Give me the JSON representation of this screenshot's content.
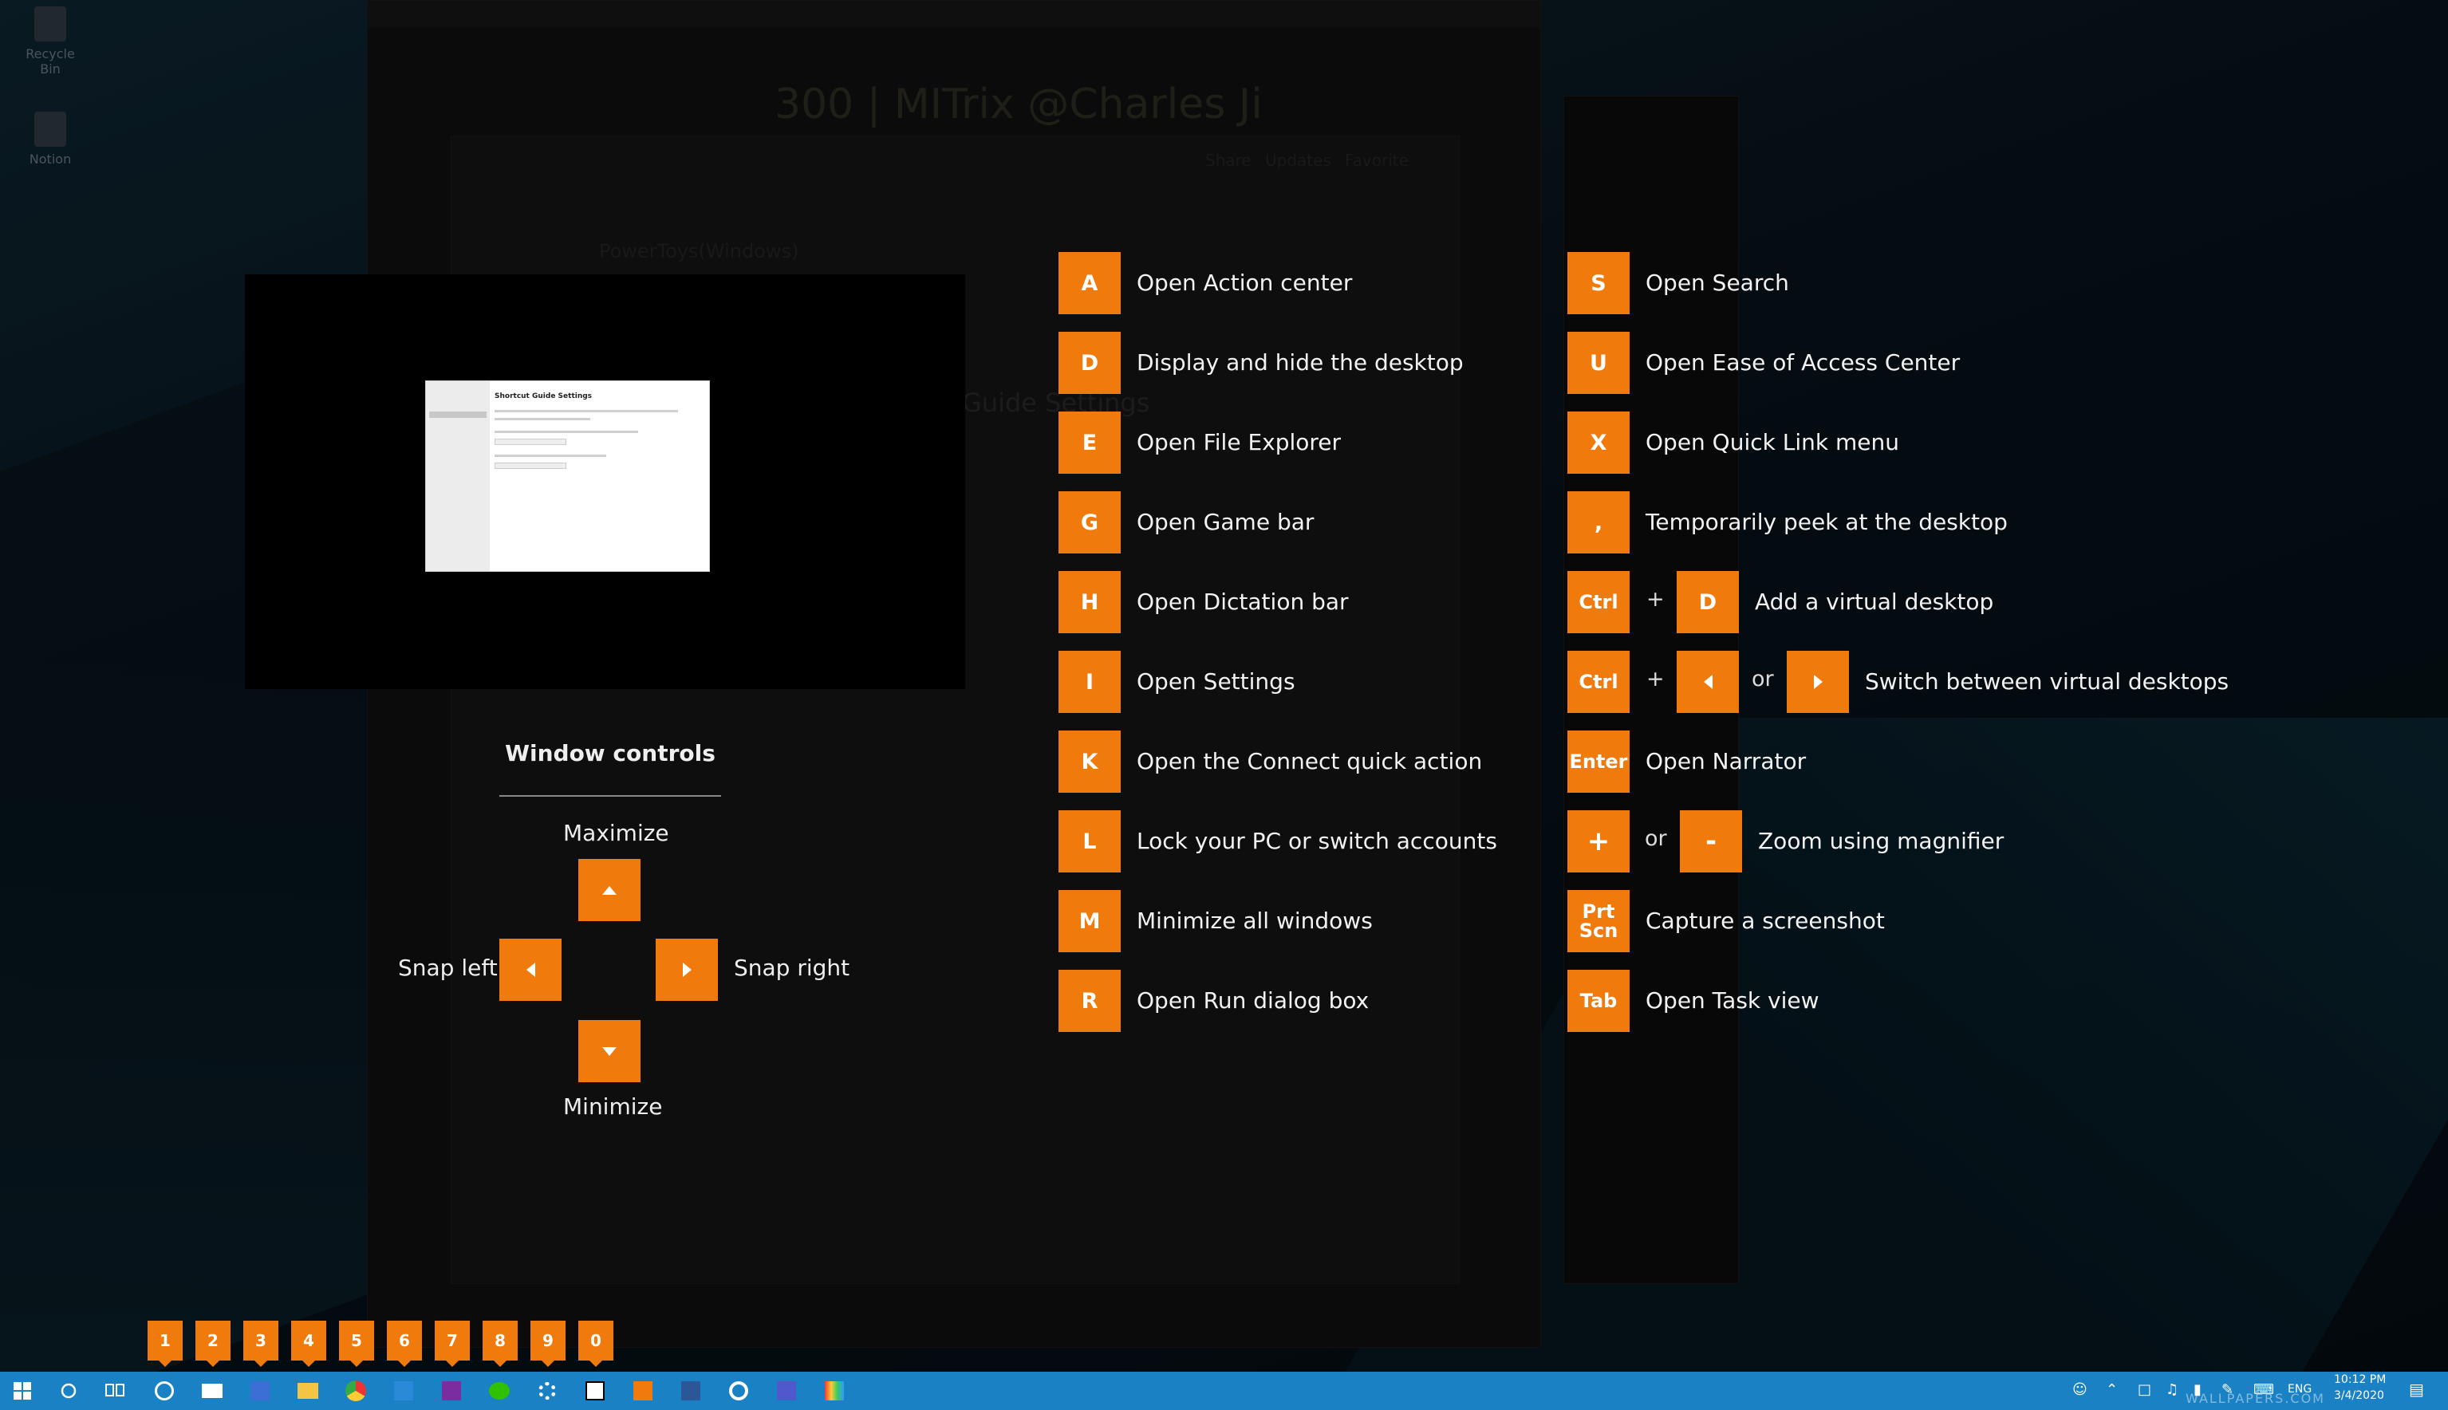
{
  "desktop": {
    "icons": [
      {
        "label": "Recycle Bin"
      },
      {
        "label": "Notion"
      }
    ]
  },
  "background": {
    "page_title": "300 | MITrix @Charles Ji",
    "window_caption": "PowerToys(Windows)",
    "settings_heading": "Guide Settings",
    "toolbar_share": "Share",
    "toolbar_updates": "Updates",
    "toolbar_favorite": "Favorite"
  },
  "preview": {
    "thumb_title": "Shortcut Guide Settings"
  },
  "window_controls": {
    "title": "Window controls",
    "maximize": "Maximize",
    "minimize": "Minimize",
    "snap_left": "Snap left",
    "snap_right": "Snap right"
  },
  "shortcuts_left": [
    {
      "key": "A",
      "desc": "Open Action center"
    },
    {
      "key": "D",
      "desc": "Display and hide the desktop"
    },
    {
      "key": "E",
      "desc": "Open File Explorer"
    },
    {
      "key": "G",
      "desc": "Open Game bar"
    },
    {
      "key": "H",
      "desc": "Open Dictation bar"
    },
    {
      "key": "I",
      "desc": "Open Settings"
    },
    {
      "key": "K",
      "desc": "Open the Connect quick action"
    },
    {
      "key": "L",
      "desc": "Lock your PC or switch accounts"
    },
    {
      "key": "M",
      "desc": "Minimize all windows"
    },
    {
      "key": "R",
      "desc": "Open Run dialog box"
    }
  ],
  "shortcuts_right": {
    "s": {
      "key": "S",
      "desc": "Open Search"
    },
    "u": {
      "key": "U",
      "desc": "Open Ease of Access Center"
    },
    "x": {
      "key": "X",
      "desc": "Open Quick Link menu"
    },
    "comma": {
      "key": ",",
      "desc": "Temporarily peek at the desktop"
    },
    "ctrl_d": {
      "key1": "Ctrl",
      "plus": "+",
      "key2": "D",
      "desc": "Add a virtual desktop"
    },
    "ctrl_arrows": {
      "key1": "Ctrl",
      "plus": "+",
      "or": "or",
      "desc": "Switch between virtual desktops"
    },
    "enter": {
      "key": "Enter",
      "desc": "Open Narrator"
    },
    "zoom": {
      "key1": "+",
      "or": "or",
      "key2": "-",
      "desc": "Zoom using magnifier"
    },
    "prtscn": {
      "key": "Prt Scn",
      "desc": "Capture a screenshot"
    },
    "tab": {
      "key": "Tab",
      "desc": "Open Task view"
    }
  },
  "taskbar": {
    "badges": [
      "1",
      "2",
      "3",
      "4",
      "5",
      "6",
      "7",
      "8",
      "9",
      "0"
    ],
    "apps": [
      "mail-search-icon",
      "mail-icon",
      "calendar-icon",
      "file-explorer-icon",
      "chrome-icon",
      "vscode-icon",
      "onenote-icon",
      "wechat-icon",
      "settings-icon",
      "notion-icon",
      "app-icon",
      "word-icon",
      "edge-icon",
      "teams-icon",
      "powertoys-icon"
    ],
    "language": "ENG",
    "time": "10:12 PM",
    "date": "3/4/2020"
  },
  "watermark": "WALLPAPERS.COM",
  "colors": {
    "accent": "#f07a0c",
    "taskbar": "#1a82c4"
  }
}
